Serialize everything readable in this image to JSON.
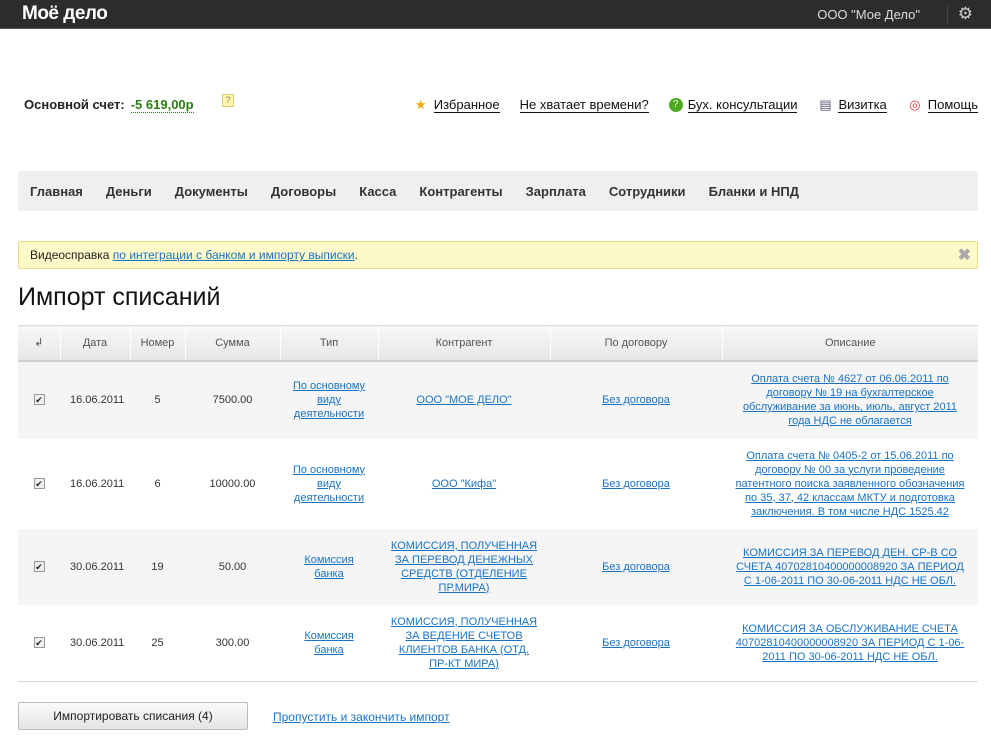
{
  "header": {
    "logo": "Моё дело",
    "org": "ООО \"Мое Дело\""
  },
  "account": {
    "label": "Основной счет:",
    "balance": "-5 619,00р",
    "help": "?"
  },
  "links": [
    {
      "label": "Избранное",
      "icon": "star-icon"
    },
    {
      "label": "Не хватает времени?",
      "icon": ""
    },
    {
      "label": "Бух. консультации",
      "icon": "chat-question-icon"
    },
    {
      "label": "Визитка",
      "icon": "card-icon"
    },
    {
      "label": "Помощь",
      "icon": "lifebuoy-icon"
    }
  ],
  "nav": [
    "Главная",
    "Деньги",
    "Документы",
    "Договоры",
    "Касса",
    "Контрагенты",
    "Зарплата",
    "Сотрудники",
    "Бланки и НПД"
  ],
  "banner": {
    "text": "Видеосправка ",
    "link": "по интеграции с банком и импорту выписки",
    "end": "."
  },
  "title": "Импорт списаний",
  "table": {
    "headers": [
      "Дата",
      "Номер",
      "Сумма",
      "Тип",
      "Контрагент",
      "По договору",
      "Описание"
    ],
    "rows": [
      {
        "checked": true,
        "date": "16.06.2011",
        "num": "5",
        "sum": "7500.00",
        "type": "По основному виду деятельности",
        "counterparty": "ООО \"МОЕ ДЕЛО\"",
        "contract": "Без договора",
        "desc": "Оплата счета № 4627 от 06.06.2011 по договору № 19 на бухгалтерское обслуживание за июнь, июль, август 2011 года НДС не облагается"
      },
      {
        "checked": true,
        "date": "16.06.2011",
        "num": "6",
        "sum": "10000.00",
        "type": "По основному виду деятельности",
        "counterparty": "ООО \"Кифа\"",
        "contract": "Без договора",
        "desc": "Оплата счета № 0405-2 от 15.06.2011 по договору № 00 за услуги проведение патентного поиска заявленного обозначения по 35, 37, 42 классам МКТУ и подготовка заключения. В том числе НДС 1525.42"
      },
      {
        "checked": true,
        "date": "30.06.2011",
        "num": "19",
        "sum": "50.00",
        "type": "Комиссия банка",
        "counterparty": "КОМИССИЯ, ПОЛУЧЕННАЯ ЗА ПЕРЕВОД ДЕНЕЖНЫХ СРЕДСТВ (ОТДЕЛЕНИЕ ПР.МИРА)",
        "contract": "Без договора",
        "desc": "КОМИССИЯ ЗА ПЕРЕВОД ДЕН. СР-В СО СЧЕТА 40702810400000008920 ЗА ПЕРИОД С 1-06-2011 ПО 30-06-2011 НДС НЕ ОБЛ."
      },
      {
        "checked": true,
        "date": "30.06.2011",
        "num": "25",
        "sum": "300.00",
        "type": "Комиссия банка",
        "counterparty": "КОМИССИЯ, ПОЛУЧЕННАЯ ЗА ВЕДЕНИЕ СЧЕТОВ КЛИЕНТОВ БАНКА (ОТД. ПР-КТ МИРА)",
        "contract": "Без договора",
        "desc": "КОМИССИЯ ЗА ОБСЛУЖИВАНИЕ СЧЕТА 40702810400000008920 ЗА ПЕРИОД С 1-06-2011 ПО 30-06-2011 НДС НЕ ОБЛ."
      }
    ]
  },
  "actions": {
    "import": "Импортировать списания (4)",
    "skip": "Пропустить и закончить импорт"
  }
}
